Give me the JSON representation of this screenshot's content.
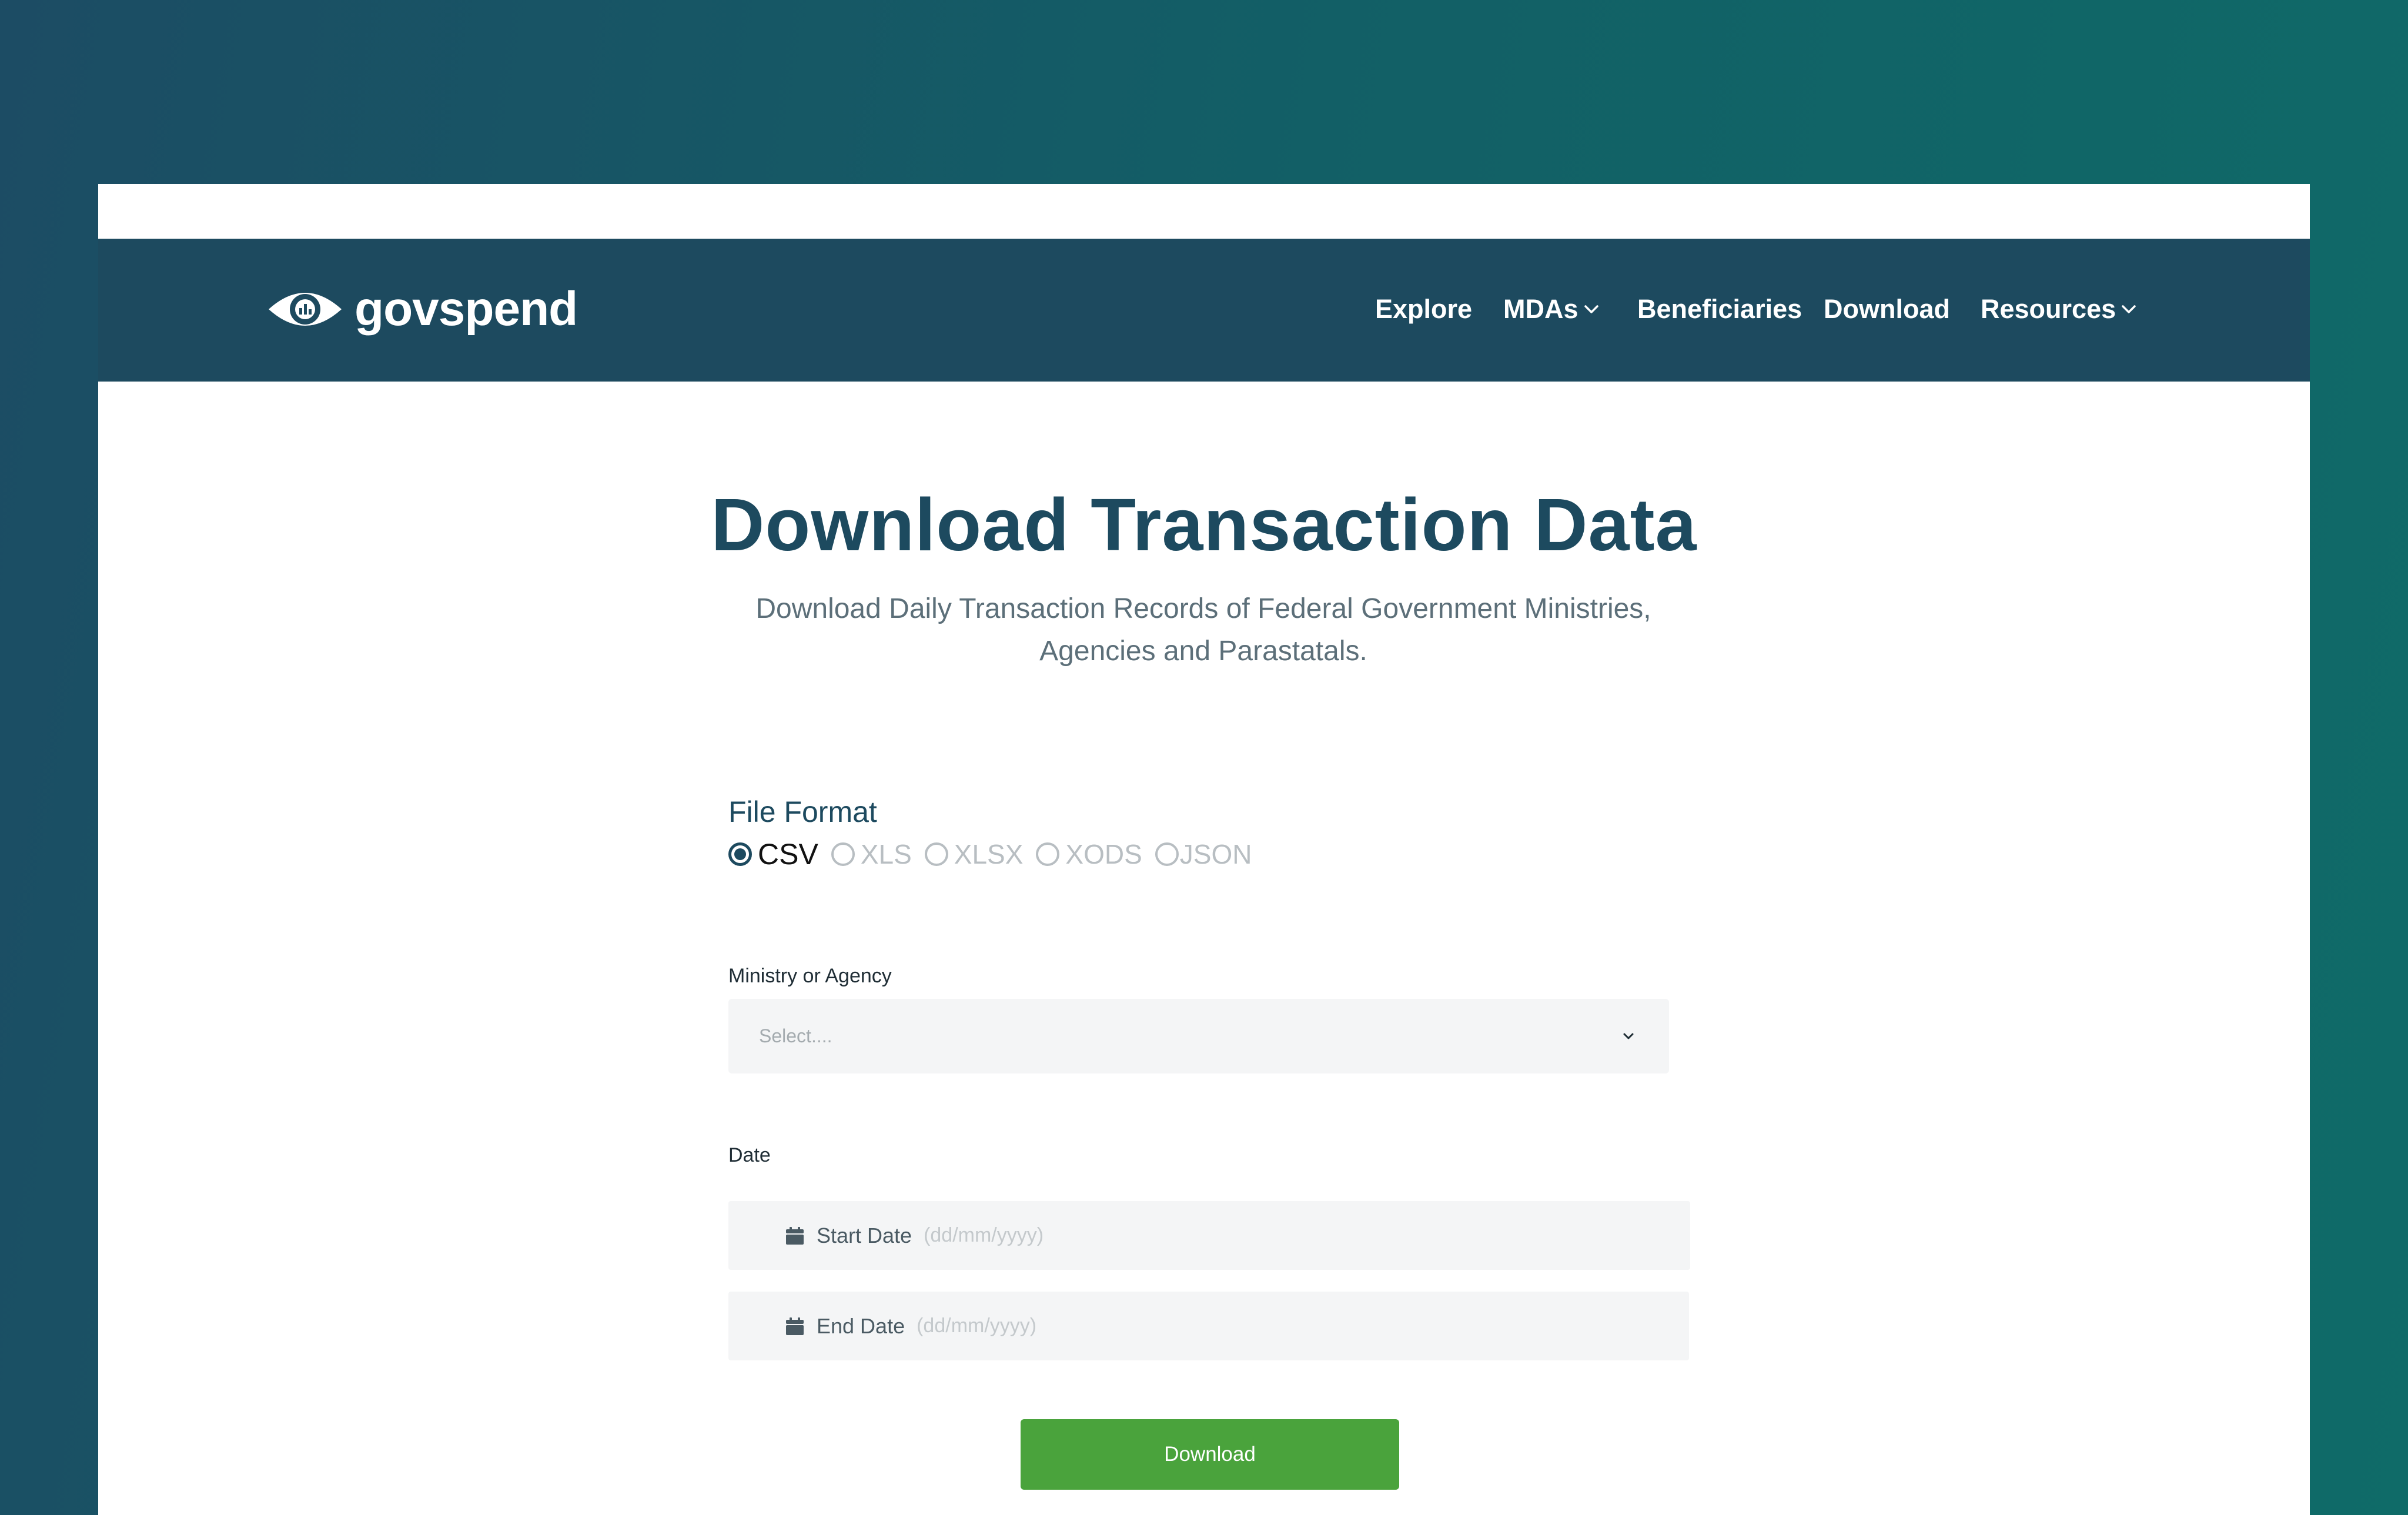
{
  "brand": {
    "name": "govspend",
    "logo_icon": "eye-chart-icon"
  },
  "nav": {
    "items": [
      {
        "label": "Explore",
        "has_dropdown": false
      },
      {
        "label": "MDAs",
        "has_dropdown": true
      },
      {
        "label": "Beneficiaries",
        "has_dropdown": false
      },
      {
        "label": "Download",
        "has_dropdown": false
      },
      {
        "label": "Resources",
        "has_dropdown": true
      }
    ]
  },
  "page": {
    "title": "Download Transaction Data",
    "subtitle": "Download Daily Transaction Records of Federal Government Ministries, Agencies and Parastatals."
  },
  "file_format": {
    "label": "File Format",
    "options": [
      "CSV",
      "XLS",
      "XLSX",
      "XODS",
      "JSON"
    ],
    "selected": "CSV"
  },
  "ministry": {
    "label": "Ministry or Agency",
    "placeholder": "Select...."
  },
  "date": {
    "label": "Date",
    "start": {
      "label": "Start Date",
      "placeholder": "(dd/mm/yyyy)"
    },
    "end": {
      "label": "End Date",
      "placeholder": "(dd/mm/yyyy)"
    }
  },
  "actions": {
    "download_label": "Download"
  },
  "colors": {
    "navy": "#1d4a5f",
    "teal_background": "#0f6b68",
    "button_green": "#4aa33c",
    "field_background": "#f4f5f6"
  }
}
